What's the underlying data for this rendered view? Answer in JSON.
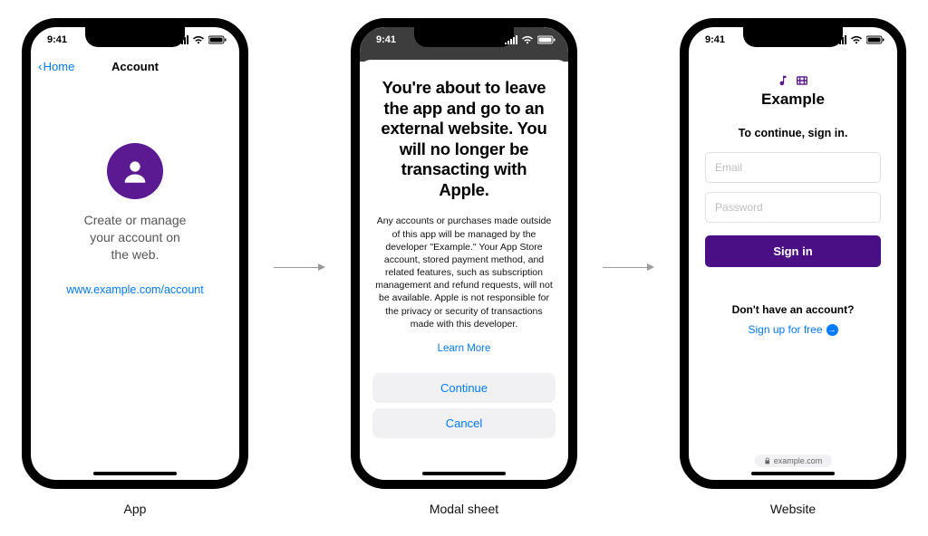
{
  "status": {
    "time": "9:41"
  },
  "captions": {
    "app": "App",
    "modal": "Modal sheet",
    "web": "Website"
  },
  "app": {
    "back": "Home",
    "title": "Account",
    "message_l1": "Create or manage",
    "message_l2": "your account on",
    "message_l3": "the web.",
    "link": "www.example.com/account"
  },
  "modal": {
    "title": "You're about to leave the app and go to an external website. You will no longer be transacting with Apple.",
    "body": "Any accounts or purchases made outside of this app will be managed by the developer \"Example.\" Your App Store account, stored payment method, and related features, such as subscription management and refund requests, will not be available. Apple is not responsible for the privacy or security of transactions made with this developer.",
    "learn": "Learn More",
    "continue": "Continue",
    "cancel": "Cancel"
  },
  "web": {
    "brand": "Example",
    "subtitle": "To continue, sign in.",
    "email_ph": "Email",
    "password_ph": "Password",
    "signin": "Sign in",
    "noacct": "Don't have an account?",
    "signup": "Sign up for free",
    "address": "example.com"
  }
}
